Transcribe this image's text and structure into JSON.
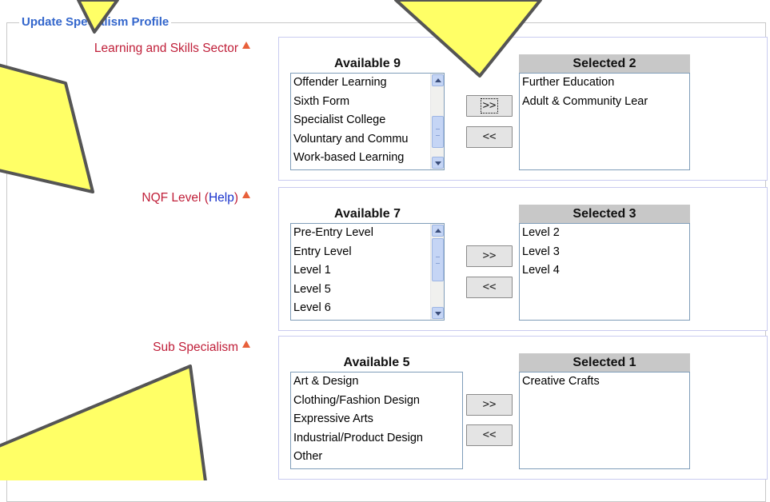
{
  "form": {
    "legend": "Update Specialism Profile"
  },
  "sections": [
    {
      "label": "Learning and Skills Sector",
      "available": {
        "title": "Available 9",
        "options": [
          "Offender Learning",
          "Sixth Form",
          "Specialist College",
          "Voluntary and Commu",
          "Work-based Learning"
        ]
      },
      "selected": {
        "title": "Selected 2",
        "options": [
          "Further Education",
          "Adult & Community Lear"
        ]
      },
      "add_button": ">>",
      "remove_button": "<<"
    },
    {
      "label": "NQF Level (",
      "help_link": "Help",
      "label_suffix": ")",
      "available": {
        "title": "Available 7",
        "options": [
          "Pre-Entry Level",
          "Entry Level",
          "Level 1",
          "Level 5",
          "Level 6"
        ]
      },
      "selected": {
        "title": "Selected 3",
        "options": [
          "Level 2",
          "Level 3",
          "Level 4"
        ]
      },
      "add_button": ">>",
      "remove_button": "<<"
    },
    {
      "label": "Sub Specialism",
      "available": {
        "title": "Available 5",
        "options": [
          "Art & Design",
          "Clothing/Fashion Design",
          "Expressive Arts",
          "Industrial/Product Design",
          "Other"
        ]
      },
      "selected": {
        "title": "Selected 1",
        "options": [
          "Creative Crafts"
        ]
      },
      "add_button": ">>",
      "remove_button": "<<"
    }
  ],
  "colors": {
    "legend": "#3366cc",
    "label": "#c0203a",
    "help_link": "#1a33cc",
    "required_marker": "#e8603a",
    "panel_border": "#c9cbf0",
    "selected_header": "#c8c8c8",
    "callout_fill": "#ffff66",
    "callout_stroke": "#555555"
  },
  "icons": {
    "required": "required-marker-icon",
    "scroll_up": "scroll-up-arrow-icon",
    "scroll_down": "scroll-down-arrow-icon"
  }
}
